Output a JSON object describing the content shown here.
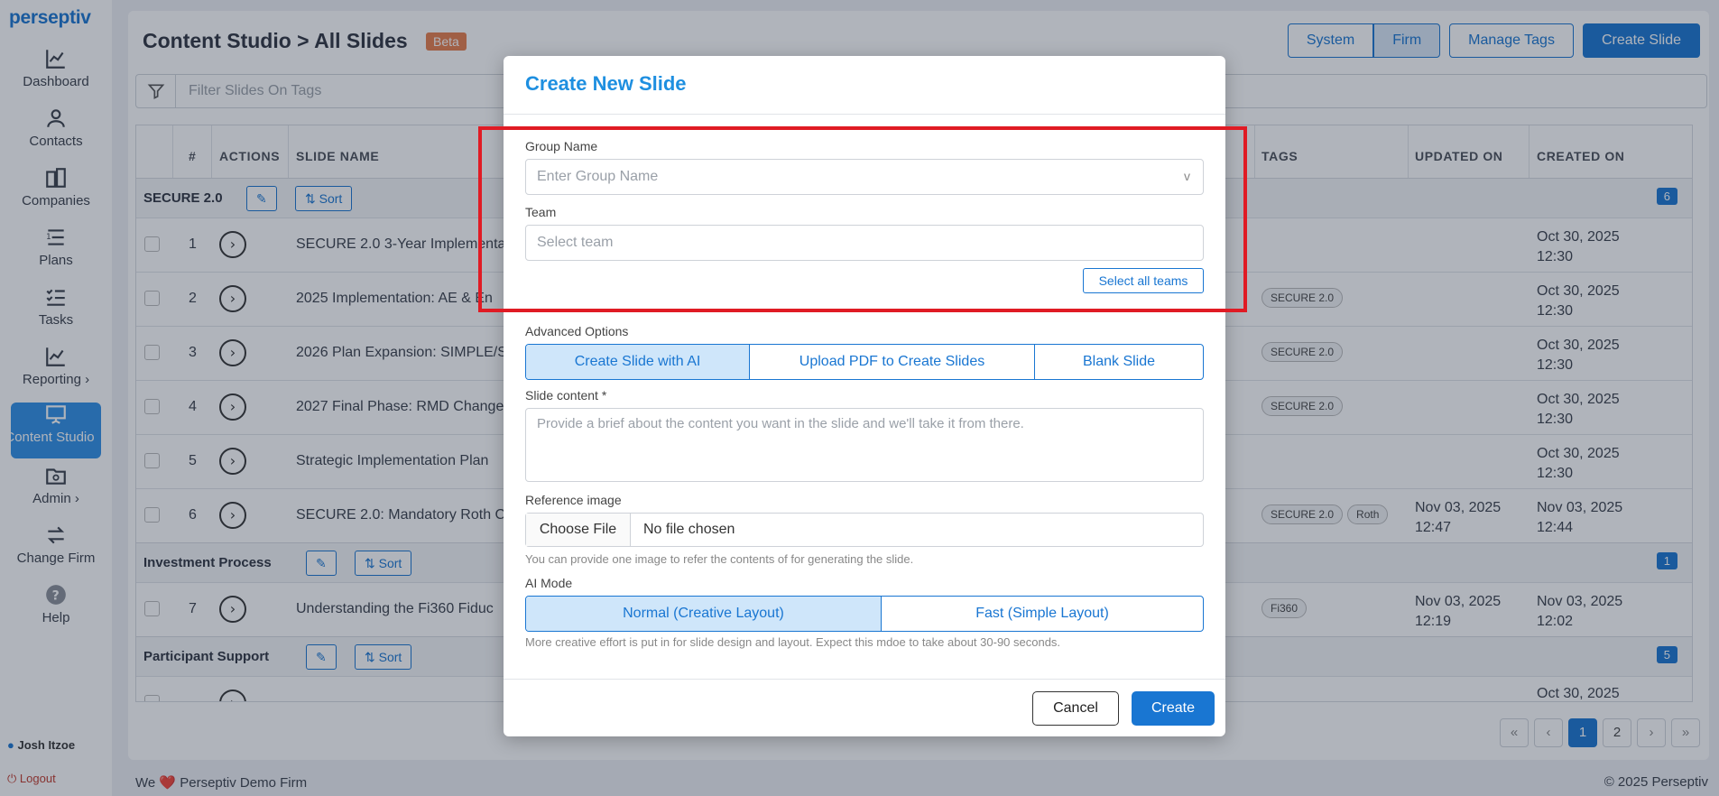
{
  "app": {
    "logo": "perseptiv"
  },
  "sidebar": {
    "items": [
      {
        "label": "Dashboard",
        "icon": "chart-line-icon"
      },
      {
        "label": "Contacts",
        "icon": "person-icon"
      },
      {
        "label": "Companies",
        "icon": "building-icon"
      },
      {
        "label": "Plans",
        "icon": "list-icon"
      },
      {
        "label": "Tasks",
        "icon": "checklist-icon"
      },
      {
        "label": "Reporting ›",
        "icon": "chart-line-icon"
      },
      {
        "label": "Content Studio",
        "icon": "presentation-icon"
      },
      {
        "label": "Admin ›",
        "icon": "folder-gear-icon"
      },
      {
        "label": "Change Firm",
        "icon": "swap-icon"
      },
      {
        "label": "Help",
        "icon": "help-icon"
      }
    ],
    "user": "Josh Itzoe",
    "logout": "Logout"
  },
  "header": {
    "title": "Content Studio > All Slides",
    "badge": "Beta",
    "buttons": {
      "system": "System",
      "firm": "Firm",
      "manage_tags": "Manage Tags",
      "create_slide": "Create Slide"
    }
  },
  "filter": {
    "placeholder": "Filter Slides On Tags"
  },
  "table": {
    "columns": {
      "num": "#",
      "actions": "ACTIONS",
      "name": "SLIDE NAME",
      "tags": "TAGS",
      "updated": "UPDATED ON",
      "created": "CREATED ON"
    },
    "edit_icon": "edit-icon",
    "sort_label": "Sort",
    "groups": [
      {
        "name": "SECURE 2.0",
        "count": "6"
      },
      {
        "name": "Investment Process",
        "count": "1"
      },
      {
        "name": "Participant Support",
        "count": "5"
      }
    ],
    "rows": [
      {
        "num": "1",
        "name": "SECURE 2.0 3-Year Implementa",
        "tags": [],
        "updated": "",
        "created": "Oct 30, 2025\n12:30"
      },
      {
        "num": "2",
        "name": "2025 Implementation: AE & En",
        "tags": [
          "SECURE 2.0"
        ],
        "updated": "",
        "created": "Oct 30, 2025\n12:30"
      },
      {
        "num": "3",
        "name": "2026 Plan Expansion: SIMPLE/S",
        "tags": [
          "SECURE 2.0"
        ],
        "updated": "",
        "created": "Oct 30, 2025\n12:30"
      },
      {
        "num": "4",
        "name": "2027 Final Phase: RMD Change",
        "tags": [
          "SECURE 2.0"
        ],
        "updated": "",
        "created": "Oct 30, 2025\n12:30"
      },
      {
        "num": "5",
        "name": "Strategic Implementation Plan",
        "tags": [],
        "updated": "",
        "created": "Oct 30, 2025\n12:30"
      },
      {
        "num": "6",
        "name": "SECURE 2.0: Mandatory Roth C",
        "tags": [
          "SECURE 2.0",
          "Roth"
        ],
        "updated": "Nov 03, 2025\n12:47",
        "created": "Nov 03, 2025\n12:44"
      },
      {
        "num": "7",
        "name": "Understanding the Fi360 Fiduc",
        "tags": [
          "Fi360"
        ],
        "updated": "Nov 03, 2025\n12:19",
        "created": "Nov 03, 2025\n12:02"
      }
    ],
    "partial_row": {
      "created": "Oct 30, 2025"
    }
  },
  "pager": {
    "first": "«",
    "prev": "‹",
    "p1": "1",
    "p2": "2",
    "next": "›",
    "last": "»"
  },
  "footer": {
    "left": "We ❤️ Perseptiv Demo Firm",
    "right": "© 2025 Perseptiv"
  },
  "modal": {
    "title": "Create New Slide",
    "group_name_label": "Group Name",
    "group_name_placeholder": "Enter Group Name",
    "group_chevron": "v",
    "team_label": "Team",
    "team_placeholder": "Select team",
    "select_all_teams": "Select all teams",
    "advanced_label": "Advanced Options",
    "advanced_options": [
      "Create Slide with AI",
      "Upload PDF to Create Slides",
      "Blank Slide"
    ],
    "slide_content_label": "Slide content *",
    "slide_content_placeholder": "Provide a brief about the content you want in the slide and we'll take it from there.",
    "reference_label": "Reference image",
    "choose_file": "Choose File",
    "no_file": "No file chosen",
    "reference_hint": "You can provide one image to refer the contents of for generating the slide.",
    "ai_mode_label": "AI Mode",
    "ai_modes": [
      "Normal (Creative Layout)",
      "Fast (Simple Layout)"
    ],
    "ai_mode_hint": "More creative effort is put in for slide design and layout. Expect this mdoe to take about 30-90 seconds.",
    "cancel": "Cancel",
    "create": "Create"
  },
  "colors": {
    "accent": "#1976d2",
    "highlight": "#e01b24",
    "beta": "#e77d4a"
  }
}
